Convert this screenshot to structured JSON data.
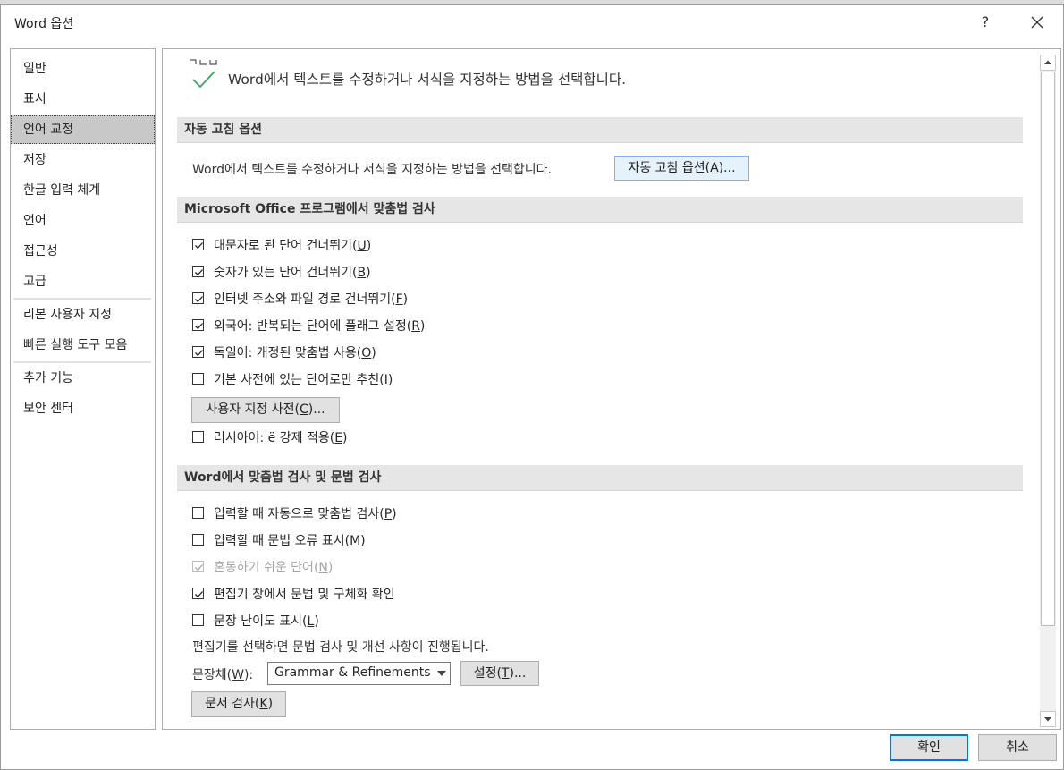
{
  "window": {
    "title": "Word 옵션",
    "help_label": "?",
    "close_label": "✕"
  },
  "sidebar": {
    "items": [
      {
        "label": "일반"
      },
      {
        "label": "표시"
      },
      {
        "label": "언어 교정",
        "selected": true
      },
      {
        "label": "저장"
      },
      {
        "label": "한글 입력 체계"
      },
      {
        "label": "언어"
      },
      {
        "label": "접근성"
      },
      {
        "label": "고급"
      },
      {
        "label": "리본 사용자 지정"
      },
      {
        "label": "빠른 실행 도구 모음"
      },
      {
        "label": "추가 기능"
      },
      {
        "label": "보안 센터"
      }
    ]
  },
  "header": {
    "icon": "proofing-check-icon",
    "text": "Word에서 텍스트를 수정하거나 서식을 지정하는 방법을 선택합니다."
  },
  "autocorrect": {
    "section_title": "자동 고침 옵션",
    "description": "Word에서 텍스트를 수정하거나 서식을 지정하는 방법을 선택합니다.",
    "button_pre": "자동 고침 옵션(",
    "button_key": "A",
    "button_post": ")..."
  },
  "office_spelling": {
    "section_title": "Microsoft Office 프로그램에서 맞춤법 검사",
    "options": [
      {
        "pre": "대문자로 된 단어 건너뛰기(",
        "key": "U",
        "post": ")",
        "checked": true,
        "disabled": false
      },
      {
        "pre": "숫자가 있는 단어 건너뛰기(",
        "key": "B",
        "post": ")",
        "checked": true,
        "disabled": false
      },
      {
        "pre": "인터넷 주소와 파일 경로 건너뛰기(",
        "key": "F",
        "post": ")",
        "checked": true,
        "disabled": false
      },
      {
        "pre": "외국어: 반복되는 단어에 플래그 설정(",
        "key": "R",
        "post": ")",
        "checked": true,
        "disabled": false
      },
      {
        "pre": "독일어: 개정된 맞춤법 사용(",
        "key": "O",
        "post": ")",
        "checked": true,
        "disabled": false
      },
      {
        "pre": "기본 사전에 있는 단어로만 추천(",
        "key": "I",
        "post": ")",
        "checked": false,
        "disabled": false
      }
    ],
    "custom_dict_pre": "사용자 지정 사전(",
    "custom_dict_key": "C",
    "custom_dict_post": ")...",
    "russian": {
      "pre": "러시아어: ë 강제 적용(",
      "key": "E",
      "post": ")",
      "checked": false,
      "disabled": false
    }
  },
  "word_spelling": {
    "section_title": "Word에서 맞춤법 검사 및 문법 검사",
    "options": [
      {
        "pre": "입력할 때 자동으로 맞춤법 검사(",
        "key": "P",
        "post": ")",
        "checked": false,
        "disabled": false
      },
      {
        "pre": "입력할 때 문법 오류 표시(",
        "key": "M",
        "post": ")",
        "checked": false,
        "disabled": false
      },
      {
        "pre": "혼동하기 쉬운 단어(",
        "key": "N",
        "post": ")",
        "checked": true,
        "disabled": true
      },
      {
        "pre": "편집기 창에서 문법 및 구체화 확인",
        "key": "",
        "post": "",
        "checked": true,
        "disabled": false
      },
      {
        "pre": "문장 난이도 표시(",
        "key": "L",
        "post": ")",
        "checked": false,
        "disabled": false
      }
    ],
    "editor_note": "편집기를 선택하면 문법 검사 및 개선 사항이 진행됩니다.",
    "style_label_pre": "문장체(",
    "style_label_key": "W",
    "style_label_post": "):",
    "style_value": "Grammar & Refinements",
    "settings_pre": "설정(",
    "settings_key": "T",
    "settings_post": ")...",
    "recheck_pre": "문서 검사(",
    "recheck_key": "K",
    "recheck_post": ")"
  },
  "footer": {
    "ok_label": "확인",
    "cancel_label": "취소"
  },
  "colors": {
    "accent": "#0078d7",
    "checkmark": "#3aa55b",
    "selected_nav": "#c8c8c8",
    "section_bg": "#e6e6e6"
  }
}
